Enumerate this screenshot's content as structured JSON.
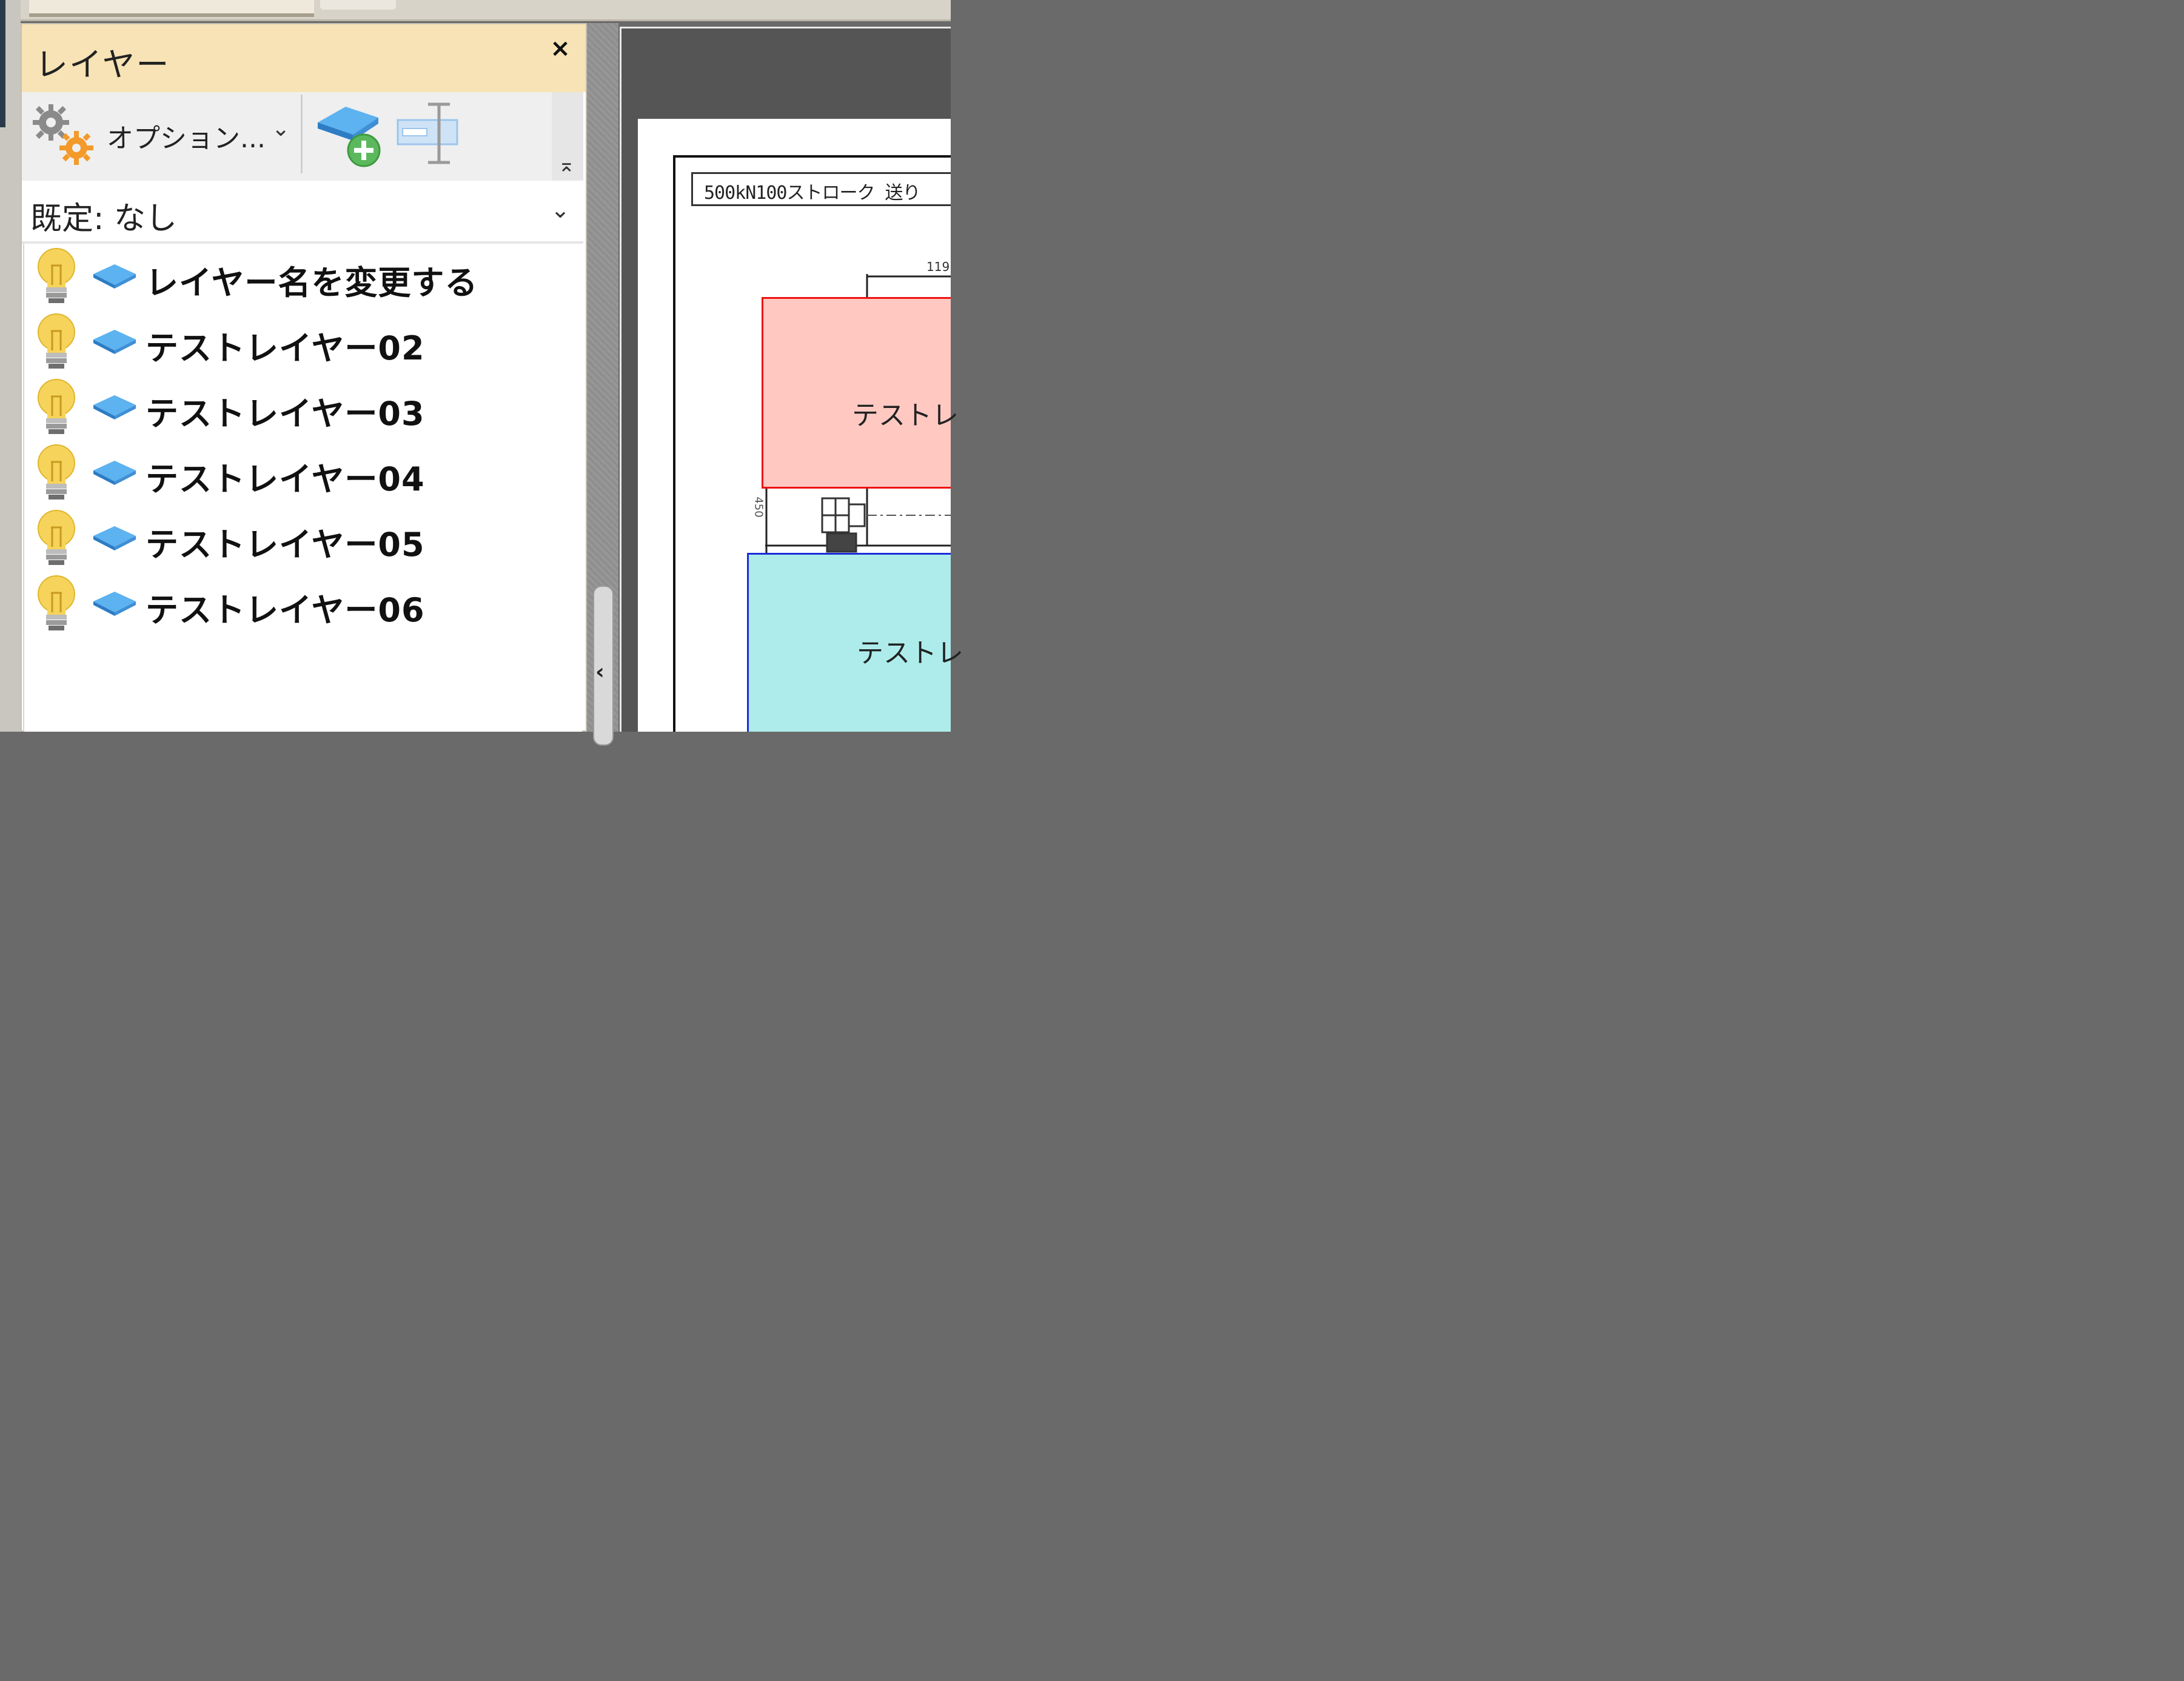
{
  "panel": {
    "title": "レイヤー",
    "close_glyph": "×"
  },
  "toolbar": {
    "options_label": "オプション...",
    "options_caret": "⌄",
    "options_icon": "gears-icon",
    "add_layer_icon": "add-layer-icon",
    "rename_icon": "rename-layer-icon",
    "collapse_glyph": "⌅"
  },
  "default_layer": {
    "label": "既定: なし",
    "caret": "⌄"
  },
  "layers": [
    {
      "name": "レイヤー名を変更する",
      "visible": true
    },
    {
      "name": "テストレイヤー02",
      "visible": true
    },
    {
      "name": "テストレイヤー03",
      "visible": true
    },
    {
      "name": "テストレイヤー04",
      "visible": true
    },
    {
      "name": "テストレイヤー05",
      "visible": true
    },
    {
      "name": "テストレイヤー06",
      "visible": true
    }
  ],
  "gutter": {
    "collapse_arrow": "‹"
  },
  "drawing": {
    "title": "500kN100ストローク 送り",
    "red_shape_label": "テストレ",
    "blue_shape_label": "テストレ",
    "dimension_top": "119",
    "dimension_side": "450"
  },
  "colors": {
    "panel_header": "#f7e3b5",
    "red_shape_fill": "#ffc9c2",
    "red_shape_border": "#ee1111",
    "blue_shape_fill": "#aeeceb",
    "blue_shape_border": "#1a2ddc",
    "bulb": "#f6d35a",
    "layer_icon": "#4aa3ea"
  }
}
